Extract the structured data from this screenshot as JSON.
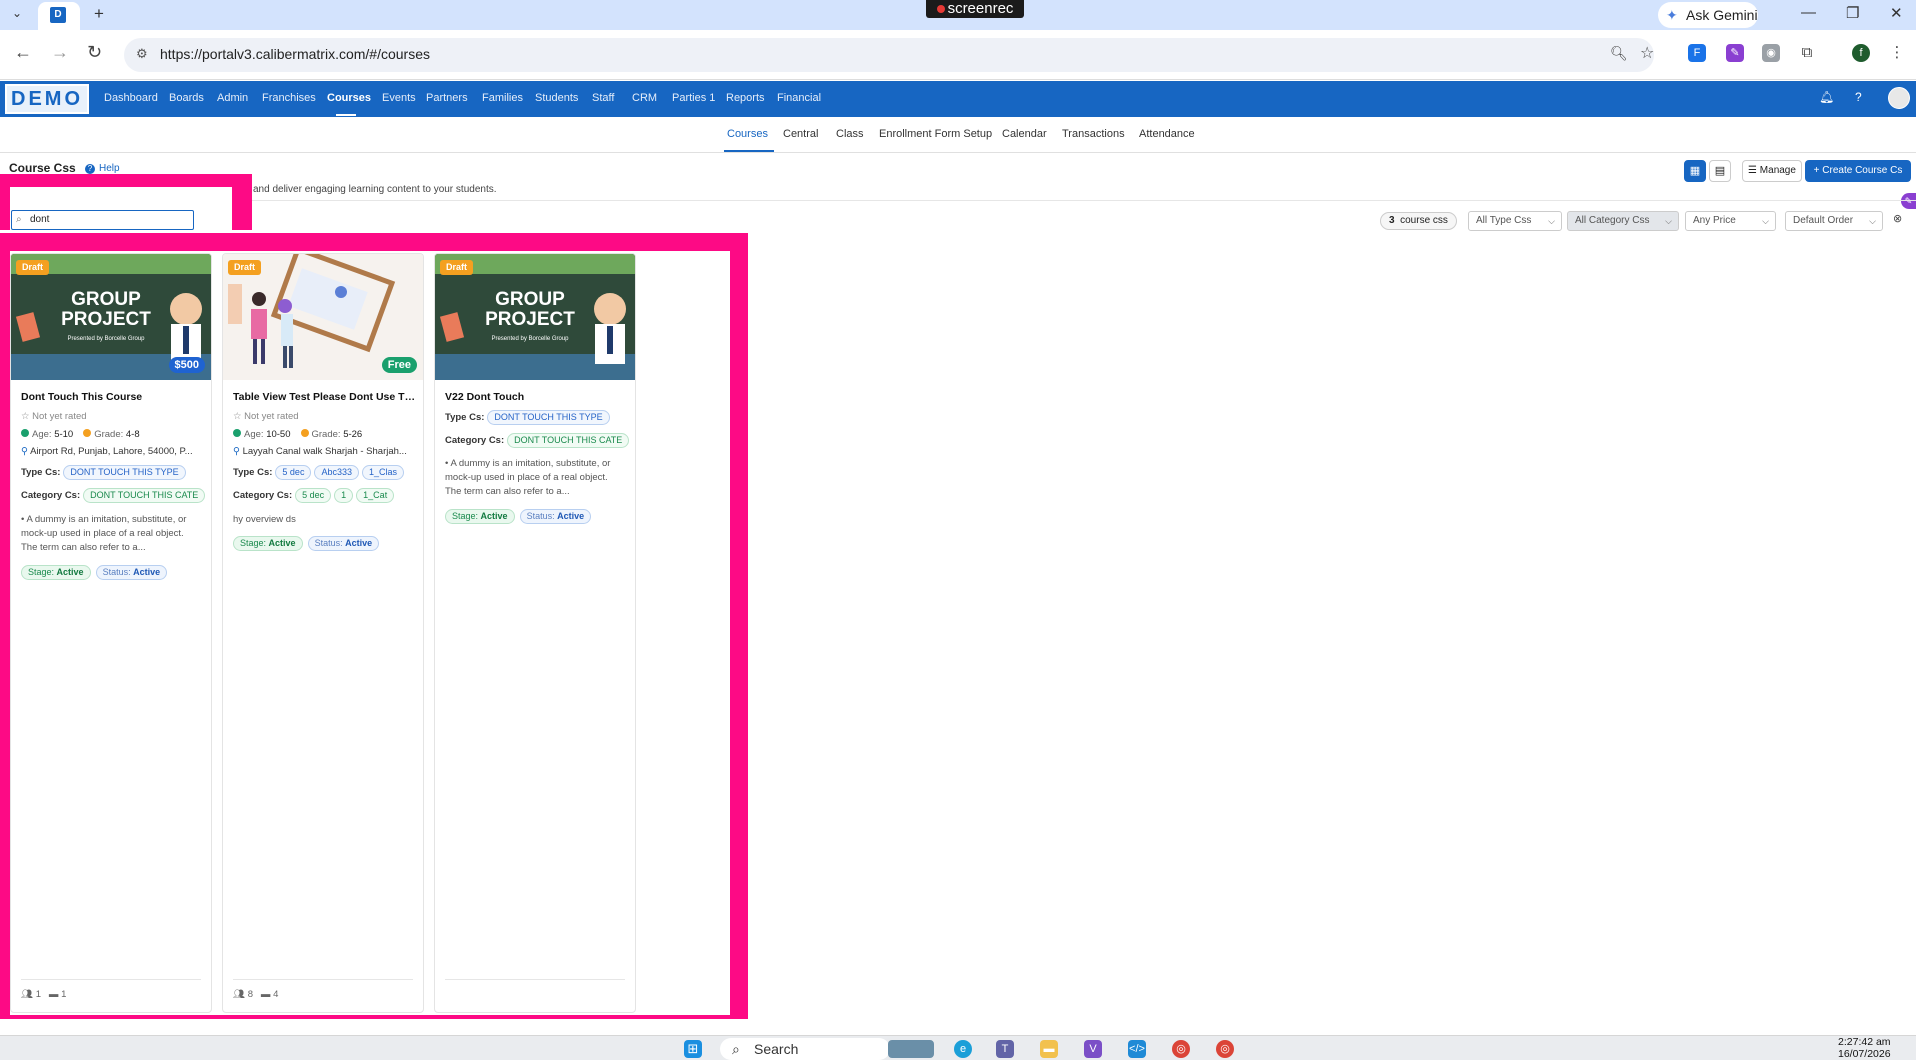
{
  "browser": {
    "screen_recorder_label": "screenrec",
    "gemini_label": "Ask Gemini",
    "url": "https://portalv3.calibermatrix.com/#/courses",
    "profile_initial": "f"
  },
  "appnav": {
    "logo": "DEMO",
    "items": [
      "Dashboard",
      "Boards",
      "Admin",
      "Franchises",
      "Courses",
      "Events",
      "Partners",
      "Families",
      "Students",
      "Staff",
      "CRM",
      "Parties 1",
      "Reports",
      "Financial"
    ],
    "active": "Courses"
  },
  "subnav": {
    "items": [
      "Courses",
      "Central",
      "Class",
      "Enrollment Form Setup",
      "Calendar",
      "Transactions",
      "Attendance"
    ],
    "active": "Courses"
  },
  "header": {
    "title": "Course Css",
    "help_label": "Help",
    "subtitle": "and deliver engaging learning content to your students.",
    "manage_label": "Manage",
    "create_label": "+ Create Course Cs"
  },
  "search": {
    "value": "dont"
  },
  "filters": {
    "count_number": "3",
    "count_label": "course css",
    "type": "All Type Css",
    "category": "All Category Css",
    "price": "Any Price",
    "order": "Default Order"
  },
  "colors": {
    "brand": "#1766c2",
    "highlight": "#fd0a85",
    "draft": "#f4a020",
    "price_paid": "#1f63d1",
    "price_free": "#1aa06d"
  },
  "cards": [
    {
      "badge": "Draft",
      "price": "$500",
      "title": "Dont Touch This Course",
      "rating": "Not yet rated",
      "age": "5-10",
      "grade": "4-8",
      "location": "Airport Rd, Punjab, Lahore, 54000, P...",
      "type_label": "Type Cs:",
      "types": [
        "DONT TOUCH THIS TYPE"
      ],
      "category_label": "Category Cs:",
      "categories": [
        "DONT TOUCH THIS CATE"
      ],
      "description": "• A dummy is an imitation, substitute, or mock-up used in place of a real object. The term can also refer to a...",
      "stage": "Active",
      "status": "Active",
      "students": "1",
      "classes": "1",
      "thumb_text": "GROUP PROJECT",
      "thumb_sub": "Presented by Borcelle Group"
    },
    {
      "badge": "Draft",
      "price": "Free",
      "title": "Table View Test Please Dont Use Th...",
      "rating": "Not yet rated",
      "age": "10-50",
      "grade": "5-26",
      "location": "Layyah Canal walk Sharjah - Sharjah...",
      "type_label": "Type Cs:",
      "types": [
        "5 dec",
        "Abc333",
        "1_Clas"
      ],
      "category_label": "Category Cs:",
      "categories": [
        "5 dec",
        "1",
        "1_Cat"
      ],
      "description": "hy overview ds",
      "stage": "Active",
      "status": "Active",
      "students": "8",
      "classes": "4"
    },
    {
      "badge": "Draft",
      "title": "V22 Dont Touch",
      "type_label": "Type Cs:",
      "types": [
        "DONT TOUCH THIS TYPE"
      ],
      "category_label": "Category Cs:",
      "categories": [
        "DONT TOUCH THIS CATE"
      ],
      "description": "• A dummy is an imitation, substitute, or mock-up used in place of a real object. The term can also refer to a...",
      "stage": "Active",
      "status": "Active",
      "thumb_text": "GROUP PROJECT",
      "thumb_sub": "Presented by Borcelle Group"
    }
  ],
  "labels": {
    "stage": "Stage:",
    "status": "Status:",
    "age": "Age:",
    "grade": "Grade:"
  },
  "taskbar": {
    "search_label": "Search",
    "time": "2:27:42 am",
    "date": "16/07/2026"
  }
}
